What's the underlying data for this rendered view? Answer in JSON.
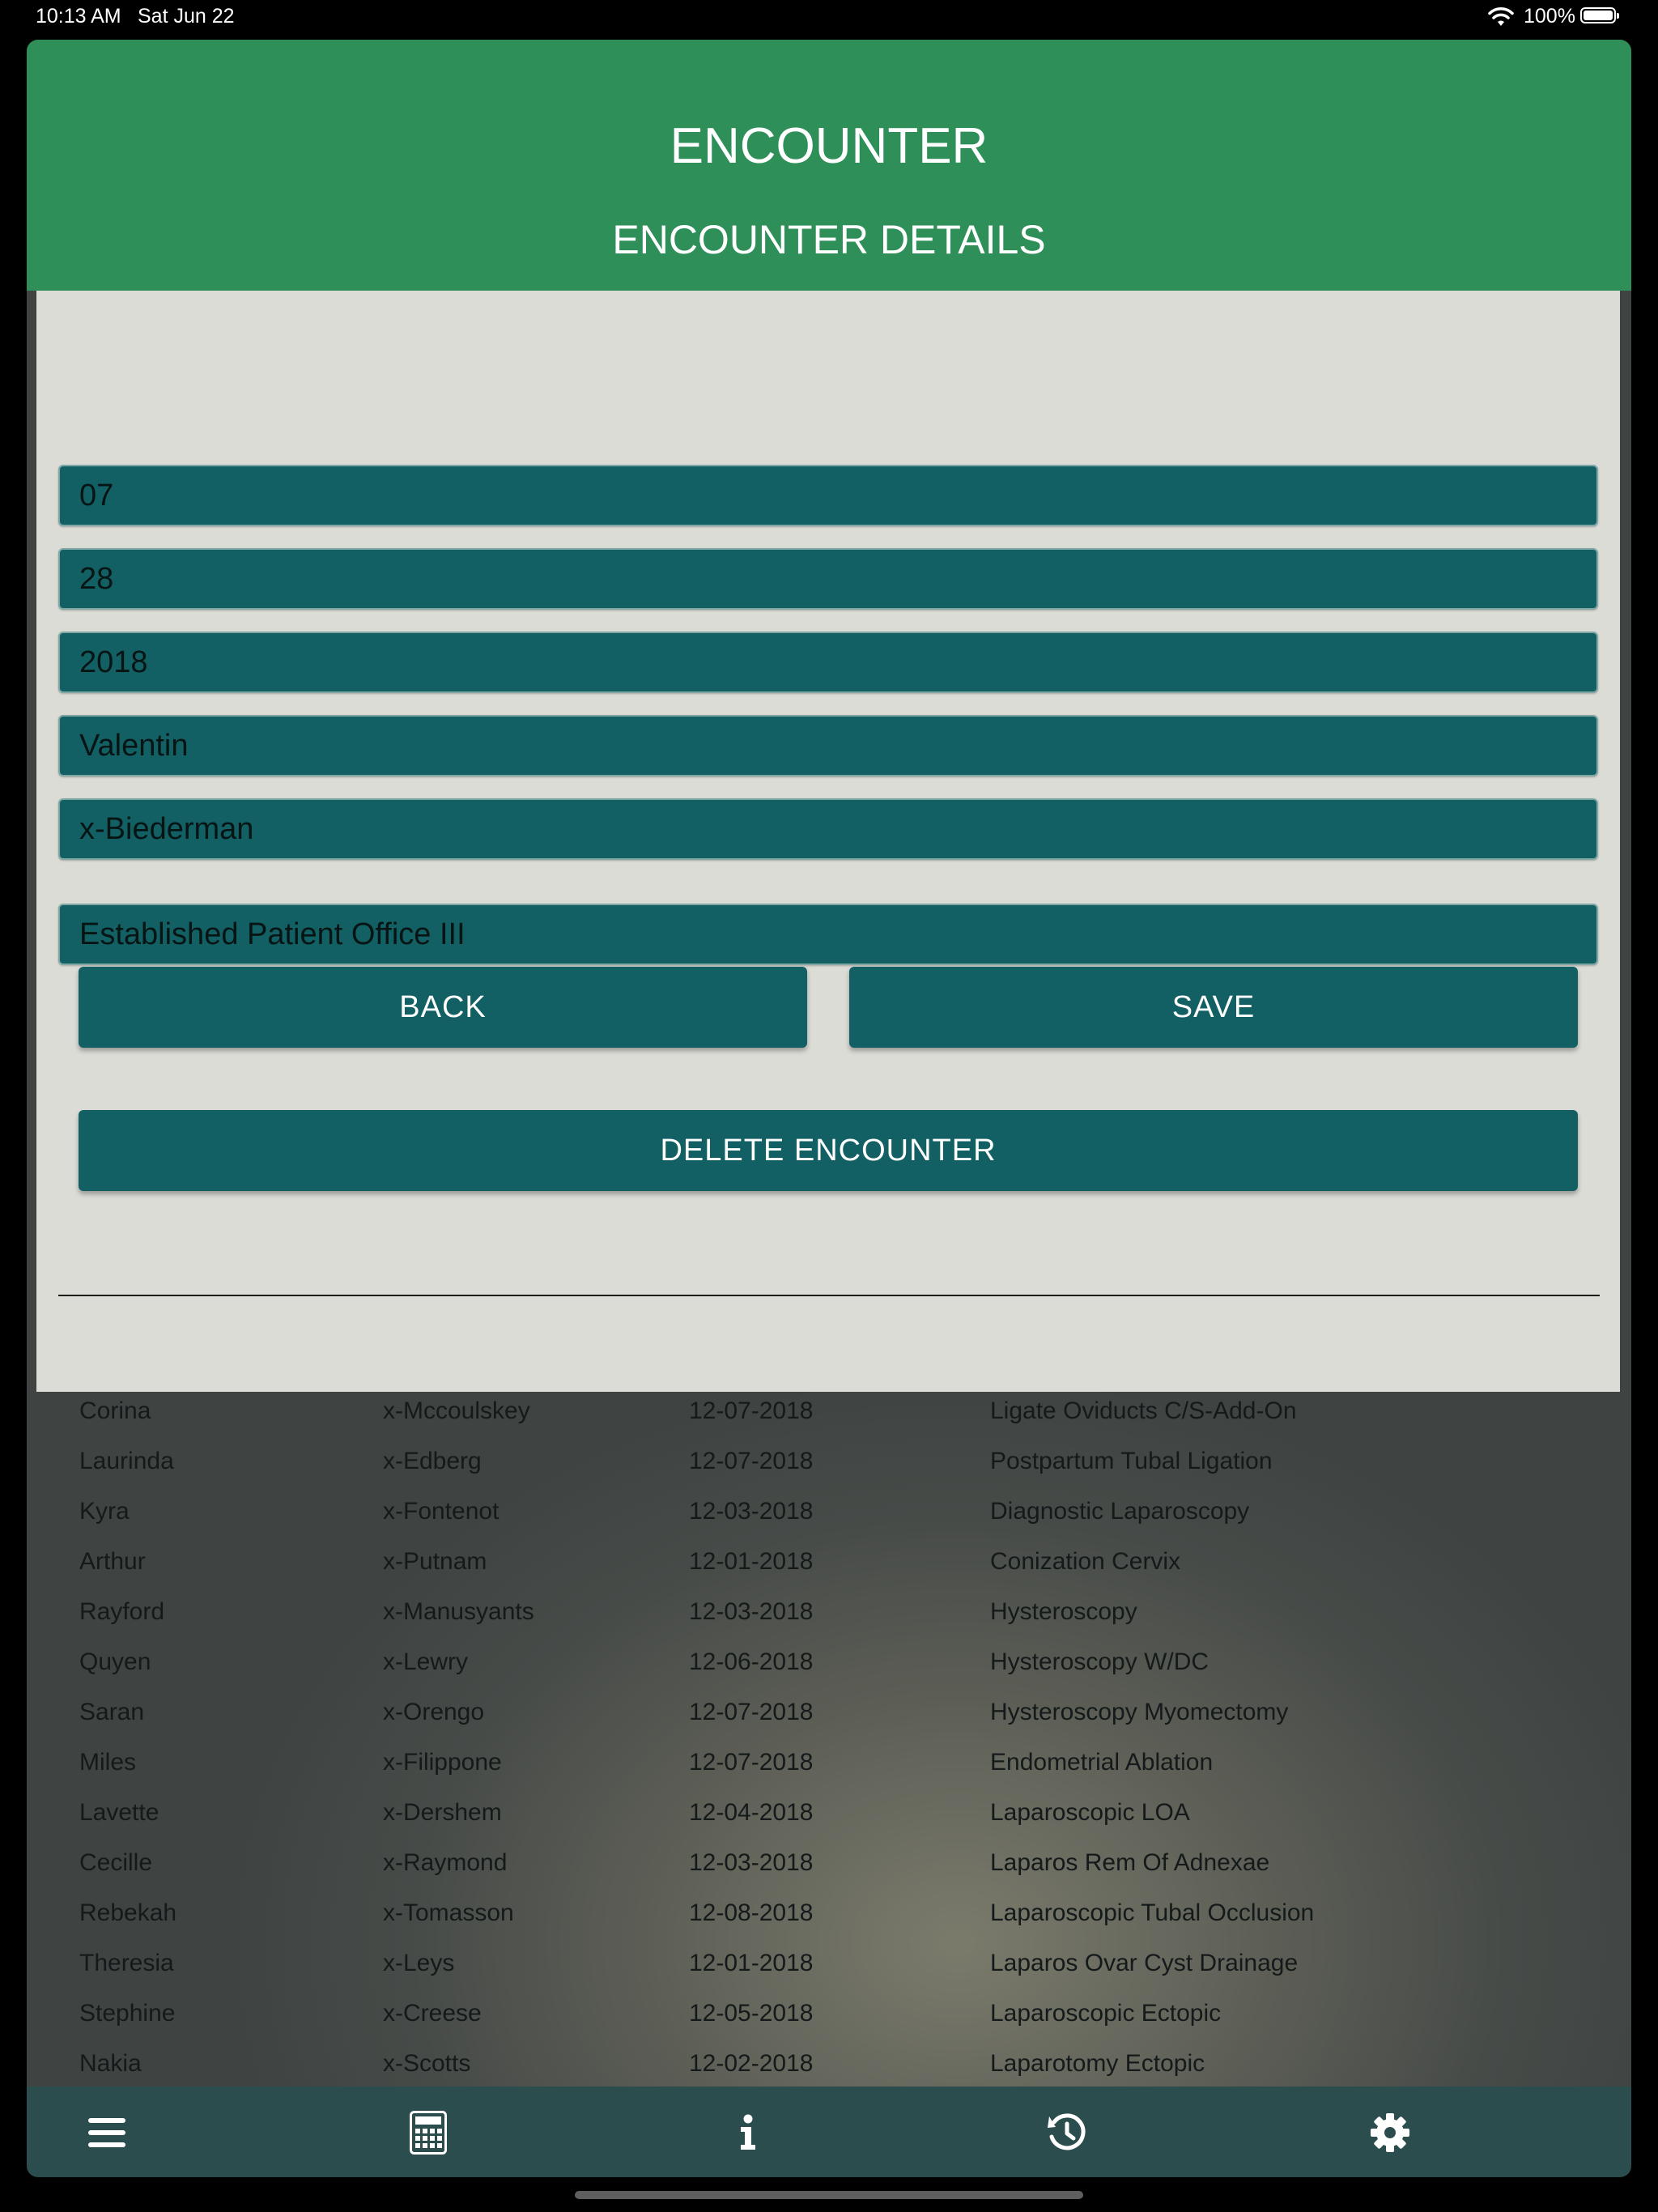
{
  "status_bar": {
    "time": "10:13 AM",
    "date": "Sat Jun 22",
    "battery": "100%"
  },
  "header": {
    "title": "ENCOUNTER",
    "subtitle": "ENCOUNTER DETAILS"
  },
  "form": {
    "month": "07",
    "day": "28",
    "year": "2018",
    "first_name": "Valentin",
    "last_name": "x-Biederman",
    "encounter_type": "Established Patient Office III"
  },
  "buttons": {
    "back": "BACK",
    "save": "SAVE",
    "delete": "DELETE ENCOUNTER"
  },
  "encounters": [
    {
      "first": "Corina",
      "last": "x-Mccoulskey",
      "date": "12-07-2018",
      "procedure": "Ligate Oviducts C/S-Add-On"
    },
    {
      "first": "Laurinda",
      "last": "x-Edberg",
      "date": "12-07-2018",
      "procedure": "Postpartum Tubal Ligation"
    },
    {
      "first": "Kyra",
      "last": "x-Fontenot",
      "date": "12-03-2018",
      "procedure": "Diagnostic Laparoscopy"
    },
    {
      "first": "Arthur",
      "last": "x-Putnam",
      "date": "12-01-2018",
      "procedure": "Conization Cervix"
    },
    {
      "first": "Rayford",
      "last": "x-Manusyants",
      "date": "12-03-2018",
      "procedure": "Hysteroscopy"
    },
    {
      "first": "Quyen",
      "last": "x-Lewry",
      "date": "12-06-2018",
      "procedure": "Hysteroscopy W/DC"
    },
    {
      "first": "Saran",
      "last": "x-Orengo",
      "date": "12-07-2018",
      "procedure": "Hysteroscopy Myomectomy"
    },
    {
      "first": "Miles",
      "last": "x-Filippone",
      "date": "12-07-2018",
      "procedure": "Endometrial Ablation"
    },
    {
      "first": "Lavette",
      "last": "x-Dershem",
      "date": "12-04-2018",
      "procedure": "Laparoscopic LOA"
    },
    {
      "first": "Cecille",
      "last": "x-Raymond",
      "date": "12-03-2018",
      "procedure": "Laparos Rem Of Adnexae"
    },
    {
      "first": "Rebekah",
      "last": "x-Tomasson",
      "date": "12-08-2018",
      "procedure": "Laparoscopic Tubal Occlusion"
    },
    {
      "first": "Theresia",
      "last": "x-Leys",
      "date": "12-01-2018",
      "procedure": "Laparos Ovar Cyst Drainage"
    },
    {
      "first": "Stephine",
      "last": "x-Creese",
      "date": "12-05-2018",
      "procedure": "Laparoscopic Ectopic"
    },
    {
      "first": "Nakia",
      "last": "x-Scotts",
      "date": "12-02-2018",
      "procedure": "Laparotomy Ectopic"
    }
  ],
  "toolbar": {
    "items": [
      "menu-icon",
      "calculator-icon",
      "info-icon",
      "history-icon",
      "gear-icon"
    ]
  },
  "colors": {
    "header_green": "#2e8f58",
    "teal": "#136064",
    "panel": "#dcdcd7",
    "toolbar": "#2c4d4d"
  }
}
